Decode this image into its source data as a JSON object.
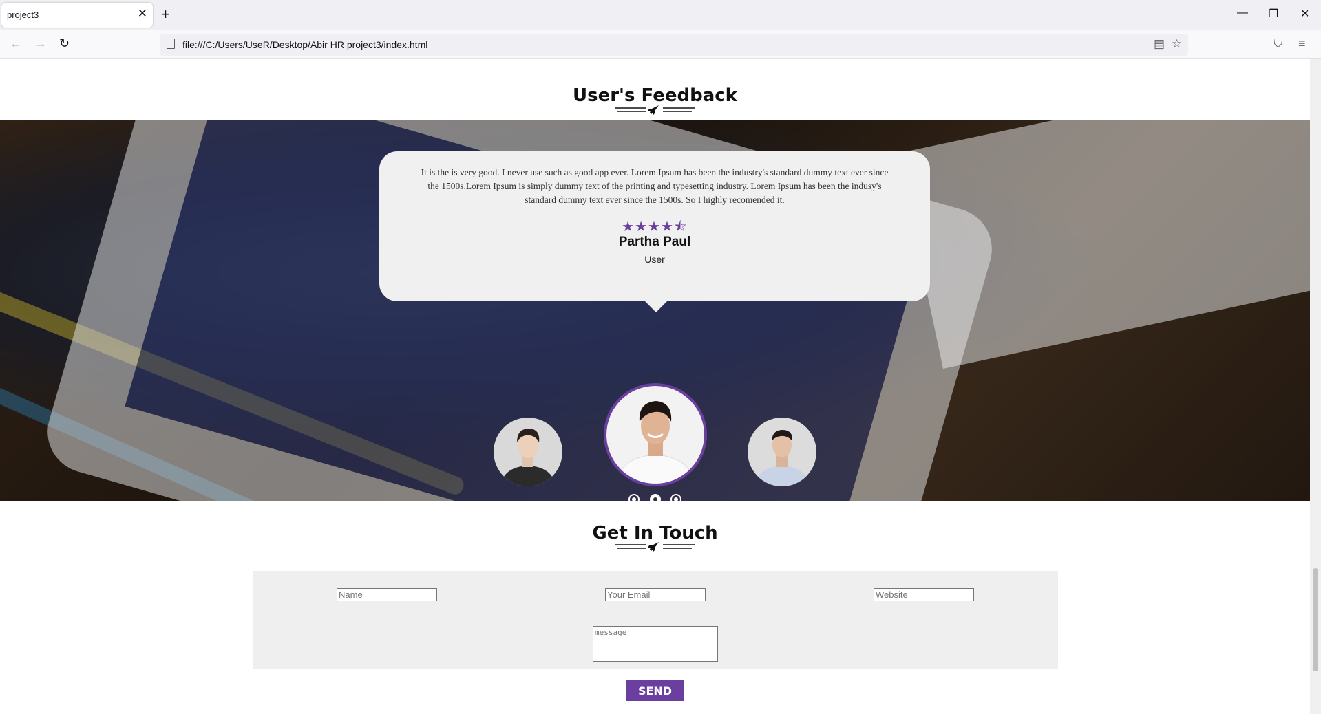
{
  "browser": {
    "tab_title": "project3",
    "url": "file:///C:/Users/UseR/Desktop/Abir HR project3/index.html"
  },
  "feedback": {
    "title": "User's Feedback",
    "quote": "It is the is very good. I never use such as good app ever. Lorem Ipsum has been the industry's standard dummy text ever since the 1500s.Lorem Ipsum is simply dummy text of the printing and typesetting industry. Lorem Ipsum has been the indusy's standard dummy text ever since the 1500s. So I highly recomended it.",
    "rating": 4.5,
    "stars": "★★★★⯪",
    "name": "Partha Paul",
    "role": "User",
    "active_slide": 2,
    "slides": 3
  },
  "contact": {
    "title": "Get In Touch",
    "name_placeholder": "Name",
    "email_placeholder": "Your Email",
    "website_placeholder": "Website",
    "message_placeholder": "message",
    "send_label": "SEND"
  },
  "colors": {
    "accent": "#6b3fa0"
  }
}
